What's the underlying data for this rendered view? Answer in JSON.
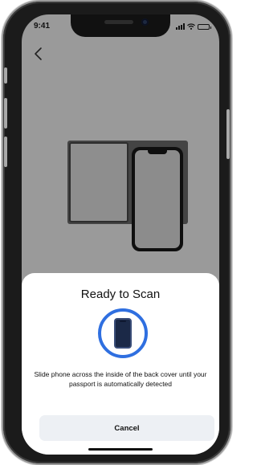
{
  "status_bar": {
    "time": "9:41",
    "icons": [
      "signal-icon",
      "wifi-icon",
      "battery-icon"
    ]
  },
  "nav": {
    "back_icon": "chevron-left-icon"
  },
  "illustration": {
    "description_icons": [
      "passport-icon",
      "phone-icon"
    ]
  },
  "sheet": {
    "title": "Ready to Scan",
    "scan_icon": "phone-scan-icon",
    "message": "Slide phone across the inside of the back cover until your passport is automatically detected",
    "cancel_label": "Cancel"
  },
  "colors": {
    "screen_background": "#9a9a9a",
    "accent": "#2f6fe0",
    "sheet_background": "#ffffff",
    "button_background": "#edf0f4"
  }
}
